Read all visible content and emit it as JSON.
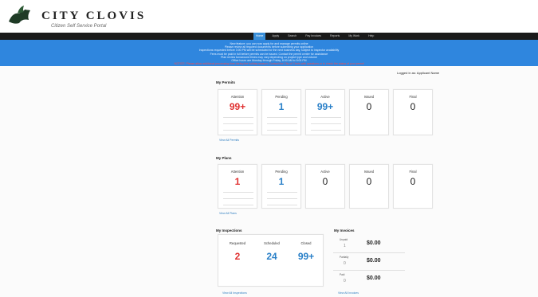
{
  "header": {
    "title": "CITY CLOVIS",
    "subtitle": "Citizen Self Service Portal"
  },
  "nav": {
    "items": [
      {
        "label": "Home",
        "active": true
      },
      {
        "label": "Apply"
      },
      {
        "label": "Search"
      },
      {
        "label": "Pay Invoices"
      },
      {
        "label": "Reports"
      },
      {
        "label": "My Work"
      },
      {
        "label": "Help"
      }
    ]
  },
  "banner": {
    "lines": [
      {
        "text": "New feature: you can now apply for and manage permits online",
        "red": false
      },
      {
        "text": "Please review all required documents before submitting your application",
        "red": false
      },
      {
        "text": "Inspections requested before 3:00 PM will be scheduled for the next business day, subject to inspector availability",
        "red": false
      },
      {
        "text": "Fees must be paid in full before permits can be issued. Contact the permit center for assistance",
        "red": false
      },
      {
        "text": "Plan review turnaround times may vary depending on project type and volume",
        "red": false
      },
      {
        "text": "Office hours are Monday through Friday, 8:00 AM to 5:00 PM",
        "red": false
      },
      {
        "text": "NOTICE: Please allow additional processing time during the holiday season. Contact the City of Clovis with questions or to check the status of your permit",
        "red": true
      }
    ]
  },
  "user": {
    "label": "Logged in as: Applicant Name"
  },
  "my_permits": {
    "title": "My Permits",
    "cards": [
      {
        "label": "Attention",
        "value": "99+",
        "color": "red"
      },
      {
        "label": "Pending",
        "value": "1",
        "color": "blue"
      },
      {
        "label": "Active",
        "value": "99+",
        "color": "blue"
      },
      {
        "label": "Issued",
        "value": "0",
        "color": "dark"
      },
      {
        "label": "Final",
        "value": "0",
        "color": "dark"
      }
    ],
    "link": "View All Permits"
  },
  "my_plans": {
    "title": "My Plans",
    "cards": [
      {
        "label": "Attention",
        "value": "1",
        "color": "red"
      },
      {
        "label": "Pending",
        "value": "1",
        "color": "blue"
      },
      {
        "label": "Active",
        "value": "0",
        "color": "dark"
      },
      {
        "label": "Issued",
        "value": "0",
        "color": "dark"
      },
      {
        "label": "Final",
        "value": "0",
        "color": "dark"
      }
    ],
    "link": "View All Plans"
  },
  "my_inspections": {
    "title": "My Inspections",
    "cards": [
      {
        "label": "Requested",
        "value": "2",
        "color": "red"
      },
      {
        "label": "Scheduled",
        "value": "24",
        "color": "blue"
      },
      {
        "label": "Closed",
        "value": "99+",
        "color": "blue"
      }
    ],
    "link": "View All Inspections"
  },
  "my_invoices": {
    "title": "My Invoices",
    "rows": [
      {
        "label": "Unpaid",
        "count": "1",
        "amount": "$0.00"
      },
      {
        "label": "Partially",
        "count": "0",
        "amount": "$0.00"
      },
      {
        "label": "Paid",
        "count": "0",
        "amount": "$0.00"
      }
    ],
    "link": "View All Invoices"
  },
  "colors": {
    "banner": "#2f86de",
    "navbar": "#1a1a1a",
    "attention": "#e03131",
    "count": "#2a80c8"
  }
}
